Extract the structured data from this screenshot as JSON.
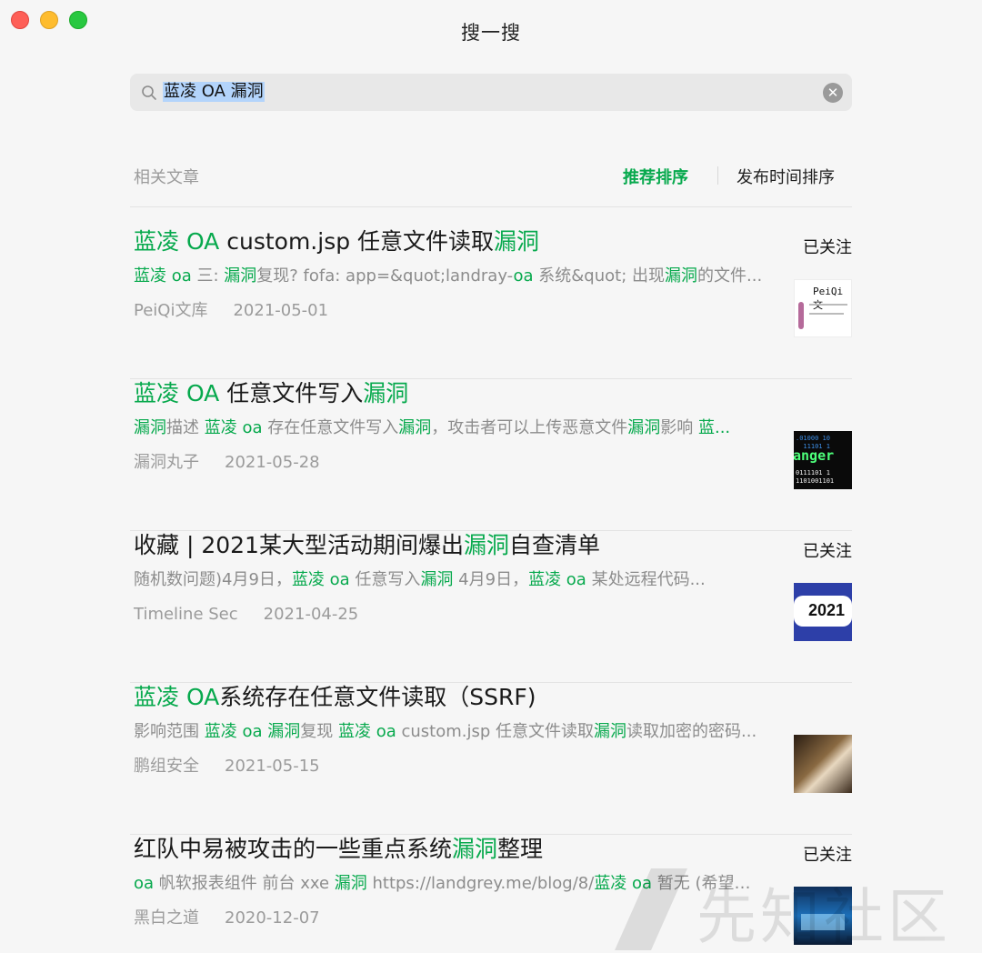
{
  "window": {
    "title": "搜一搜"
  },
  "search": {
    "query": "蓝凌 OA 漏洞"
  },
  "section": {
    "label": "相关文章"
  },
  "sort": {
    "recommended": "推荐排序",
    "by_time": "发布时间排序"
  },
  "colors": {
    "accent": "#07a94d",
    "selection": "#b3d4fb"
  },
  "results": [
    {
      "title": [
        {
          "t": "蓝凌 OA",
          "hl": true
        },
        {
          "t": " custom.jsp 任意文件读取",
          "hl": false
        },
        {
          "t": "漏洞",
          "hl": true
        }
      ],
      "snippet": [
        {
          "t": "蓝凌 oa",
          "hl": true
        },
        {
          "t": " 三: ",
          "hl": false
        },
        {
          "t": "漏洞",
          "hl": true
        },
        {
          "t": "复现? fofa: app=&quot;landray-",
          "hl": false
        },
        {
          "t": "oa",
          "hl": true
        },
        {
          "t": " 系统&quot; 出现",
          "hl": false
        },
        {
          "t": "漏洞",
          "hl": true
        },
        {
          "t": "的文件...",
          "hl": false
        }
      ],
      "source": "PeiQi文库",
      "date": "2021-05-01",
      "follow": "已关注",
      "thumb_text": "PeiQi 文"
    },
    {
      "title": [
        {
          "t": "蓝凌 OA",
          "hl": true
        },
        {
          "t": " 任意文件写入",
          "hl": false
        },
        {
          "t": "漏洞",
          "hl": true
        }
      ],
      "snippet": [
        {
          "t": "漏洞",
          "hl": true
        },
        {
          "t": "描述 ",
          "hl": false
        },
        {
          "t": "蓝凌 oa",
          "hl": true
        },
        {
          "t": " 存在任意文件写入",
          "hl": false
        },
        {
          "t": "漏洞",
          "hl": true
        },
        {
          "t": "，攻击者可以上传恶意文件",
          "hl": false
        },
        {
          "t": "漏洞",
          "hl": true
        },
        {
          "t": "影响 ",
          "hl": false
        },
        {
          "t": "蓝...",
          "hl": true
        }
      ],
      "source": "漏洞丸子",
      "date": "2021-05-28",
      "follow": "",
      "thumb_text": "anger"
    },
    {
      "title": [
        {
          "t": "收藏 | 2021某大型活动期间爆出",
          "hl": false
        },
        {
          "t": "漏洞",
          "hl": true
        },
        {
          "t": "自查清单",
          "hl": false
        }
      ],
      "snippet": [
        {
          "t": "随机数问题)4月9日，",
          "hl": false
        },
        {
          "t": "蓝凌 oa",
          "hl": true
        },
        {
          "t": " 任意写入",
          "hl": false
        },
        {
          "t": "漏洞",
          "hl": true
        },
        {
          "t": " 4月9日，",
          "hl": false
        },
        {
          "t": "蓝凌 oa",
          "hl": true
        },
        {
          "t": " 某处远程代码...",
          "hl": false
        }
      ],
      "source": "Timeline Sec",
      "date": "2021-04-25",
      "follow": "已关注",
      "thumb_text": "2021"
    },
    {
      "title": [
        {
          "t": "蓝凌 OA",
          "hl": true
        },
        {
          "t": "系统存在任意文件读取（SSRF)",
          "hl": false
        }
      ],
      "snippet": [
        {
          "t": "影响范围 ",
          "hl": false
        },
        {
          "t": "蓝凌 oa",
          "hl": true
        },
        {
          "t": " ",
          "hl": false
        },
        {
          "t": "漏洞",
          "hl": true
        },
        {
          "t": "复现 ",
          "hl": false
        },
        {
          "t": "蓝凌 oa",
          "hl": true
        },
        {
          "t": " custom.jsp 任意文件读取",
          "hl": false
        },
        {
          "t": "漏洞",
          "hl": true
        },
        {
          "t": "读取加密的密码...",
          "hl": false
        }
      ],
      "source": "鹏组安全",
      "date": "2021-05-15",
      "follow": "",
      "thumb_text": ""
    },
    {
      "title": [
        {
          "t": "红队中易被攻击的一些重点系统",
          "hl": false
        },
        {
          "t": "漏洞",
          "hl": true
        },
        {
          "t": "整理",
          "hl": false
        }
      ],
      "snippet": [
        {
          "t": "oa",
          "hl": true
        },
        {
          "t": " 帆软报表组件 前台 xxe ",
          "hl": false
        },
        {
          "t": "漏洞",
          "hl": true
        },
        {
          "t": " https://landgrey.me/blog/8/",
          "hl": false
        },
        {
          "t": "蓝凌 oa",
          "hl": true
        },
        {
          "t": " 暂无 (希望大...",
          "hl": false
        }
      ],
      "source": "黑白之道",
      "date": "2020-12-07",
      "follow": "已关注",
      "thumb_text": ""
    }
  ],
  "watermark": {
    "text": "先知社区"
  }
}
